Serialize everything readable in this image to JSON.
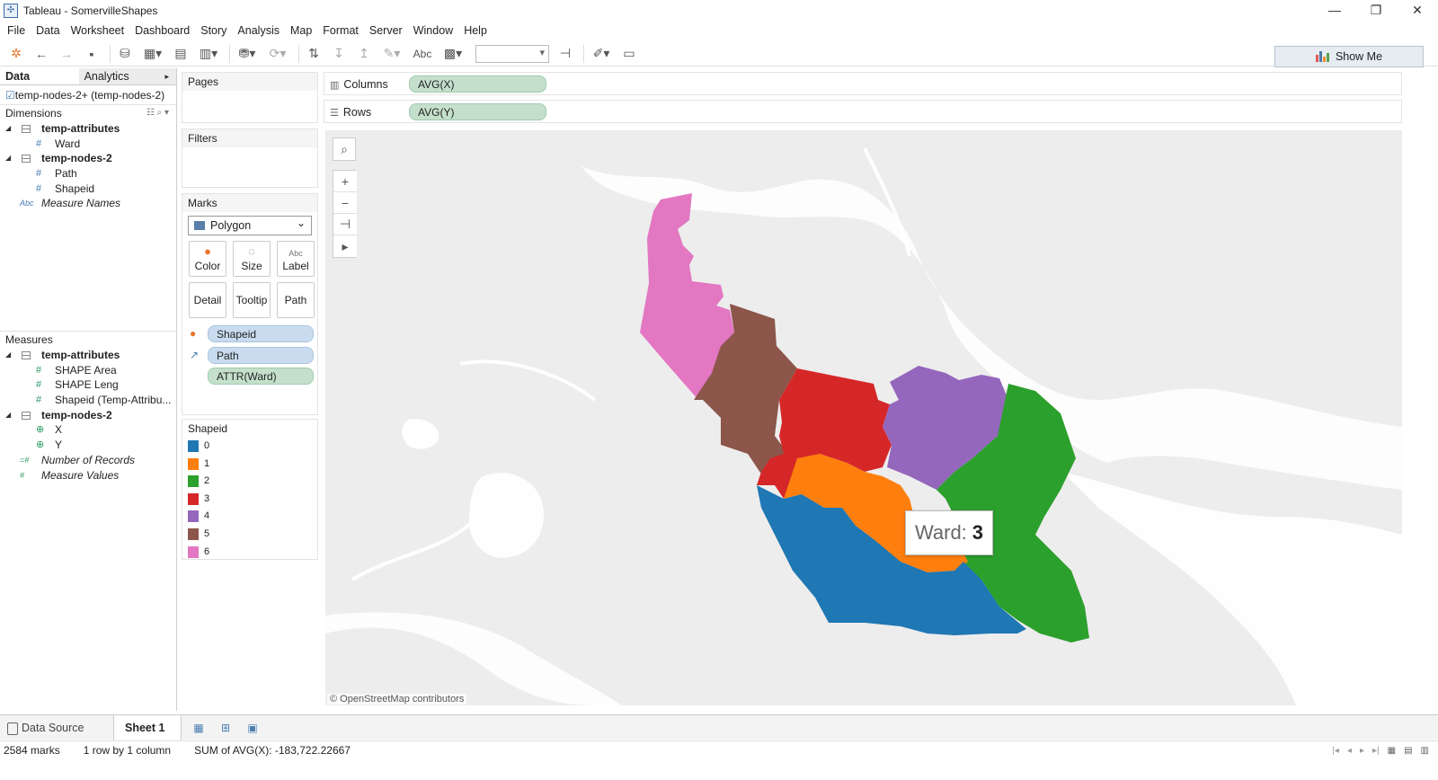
{
  "window": {
    "title": "Tableau - SomervilleShapes",
    "minimize": "—",
    "maximize": "❐",
    "close": "✕"
  },
  "menu": [
    "File",
    "Data",
    "Worksheet",
    "Dashboard",
    "Story",
    "Analysis",
    "Map",
    "Format",
    "Server",
    "Window",
    "Help"
  ],
  "toolbar": {
    "text_button": "Abc",
    "show_me": "Show Me",
    "show_me_colors": [
      "#e15759",
      "#4e79a7",
      "#f28e2b",
      "#59a14f"
    ]
  },
  "data_pane": {
    "tabs": [
      "Data",
      "Analytics"
    ],
    "data_source": "temp-nodes-2+ (temp-nodes-2)",
    "dimensions_label": "Dimensions",
    "dimensions": [
      {
        "type": "group",
        "name": "temp-attributes"
      },
      {
        "type": "field",
        "icon": "#",
        "name": "Ward"
      },
      {
        "type": "group",
        "name": "temp-nodes-2"
      },
      {
        "type": "field",
        "icon": "#",
        "name": "Path"
      },
      {
        "type": "field",
        "icon": "#",
        "name": "Shapeid"
      },
      {
        "type": "italic",
        "icon": "Abc",
        "name": "Measure Names"
      }
    ],
    "measures_label": "Measures",
    "measures": [
      {
        "type": "group",
        "name": "temp-attributes"
      },
      {
        "type": "field",
        "icon": "#",
        "name": "SHAPE Area"
      },
      {
        "type": "field",
        "icon": "#",
        "name": "SHAPE Leng"
      },
      {
        "type": "field",
        "icon": "#",
        "name": "Shapeid (Temp-Attribu..."
      },
      {
        "type": "group",
        "name": "temp-nodes-2"
      },
      {
        "type": "field",
        "icon": "⊕",
        "name": "X"
      },
      {
        "type": "field",
        "icon": "⊕",
        "name": "Y"
      },
      {
        "type": "italic",
        "icon": "=#",
        "name": "Number of Records"
      },
      {
        "type": "italic",
        "icon": "#",
        "name": "Measure Values"
      }
    ]
  },
  "cards": {
    "pages": "Pages",
    "filters": "Filters",
    "marks": "Marks",
    "mark_type": "Polygon",
    "mark_buttons": [
      "Color",
      "Size",
      "Label",
      "Detail",
      "Tooltip",
      "Path"
    ],
    "label_glyph": "Abc",
    "pills": [
      {
        "icon": "color-icon",
        "label": "Shapeid",
        "kind": "blue"
      },
      {
        "icon": "path-icon",
        "label": "Path",
        "kind": "blue"
      },
      {
        "icon": "",
        "label": "ATTR(Ward)",
        "kind": "green"
      }
    ]
  },
  "legend": {
    "title": "Shapeid",
    "items": [
      {
        "label": "0",
        "color": "#1f77b4"
      },
      {
        "label": "1",
        "color": "#ff7f0e"
      },
      {
        "label": "2",
        "color": "#2ca02c"
      },
      {
        "label": "3",
        "color": "#d62728"
      },
      {
        "label": "4",
        "color": "#9467bd"
      },
      {
        "label": "5",
        "color": "#8c564b"
      },
      {
        "label": "6",
        "color": "#e377c2"
      }
    ]
  },
  "shelves": {
    "columns_label": "Columns",
    "columns_pill": "AVG(X)",
    "rows_label": "Rows",
    "rows_pill": "AVG(Y)"
  },
  "map": {
    "tooltip_label": "Ward:",
    "tooltip_value": "3",
    "attribution": "© OpenStreetMap contributors"
  },
  "sheet_tabs": {
    "data_source": "Data Source",
    "active_sheet": "Sheet 1"
  },
  "status": {
    "marks": "2584 marks",
    "dims": "1 row by 1 column",
    "sum": "SUM of AVG(X): -183,722.22667"
  }
}
